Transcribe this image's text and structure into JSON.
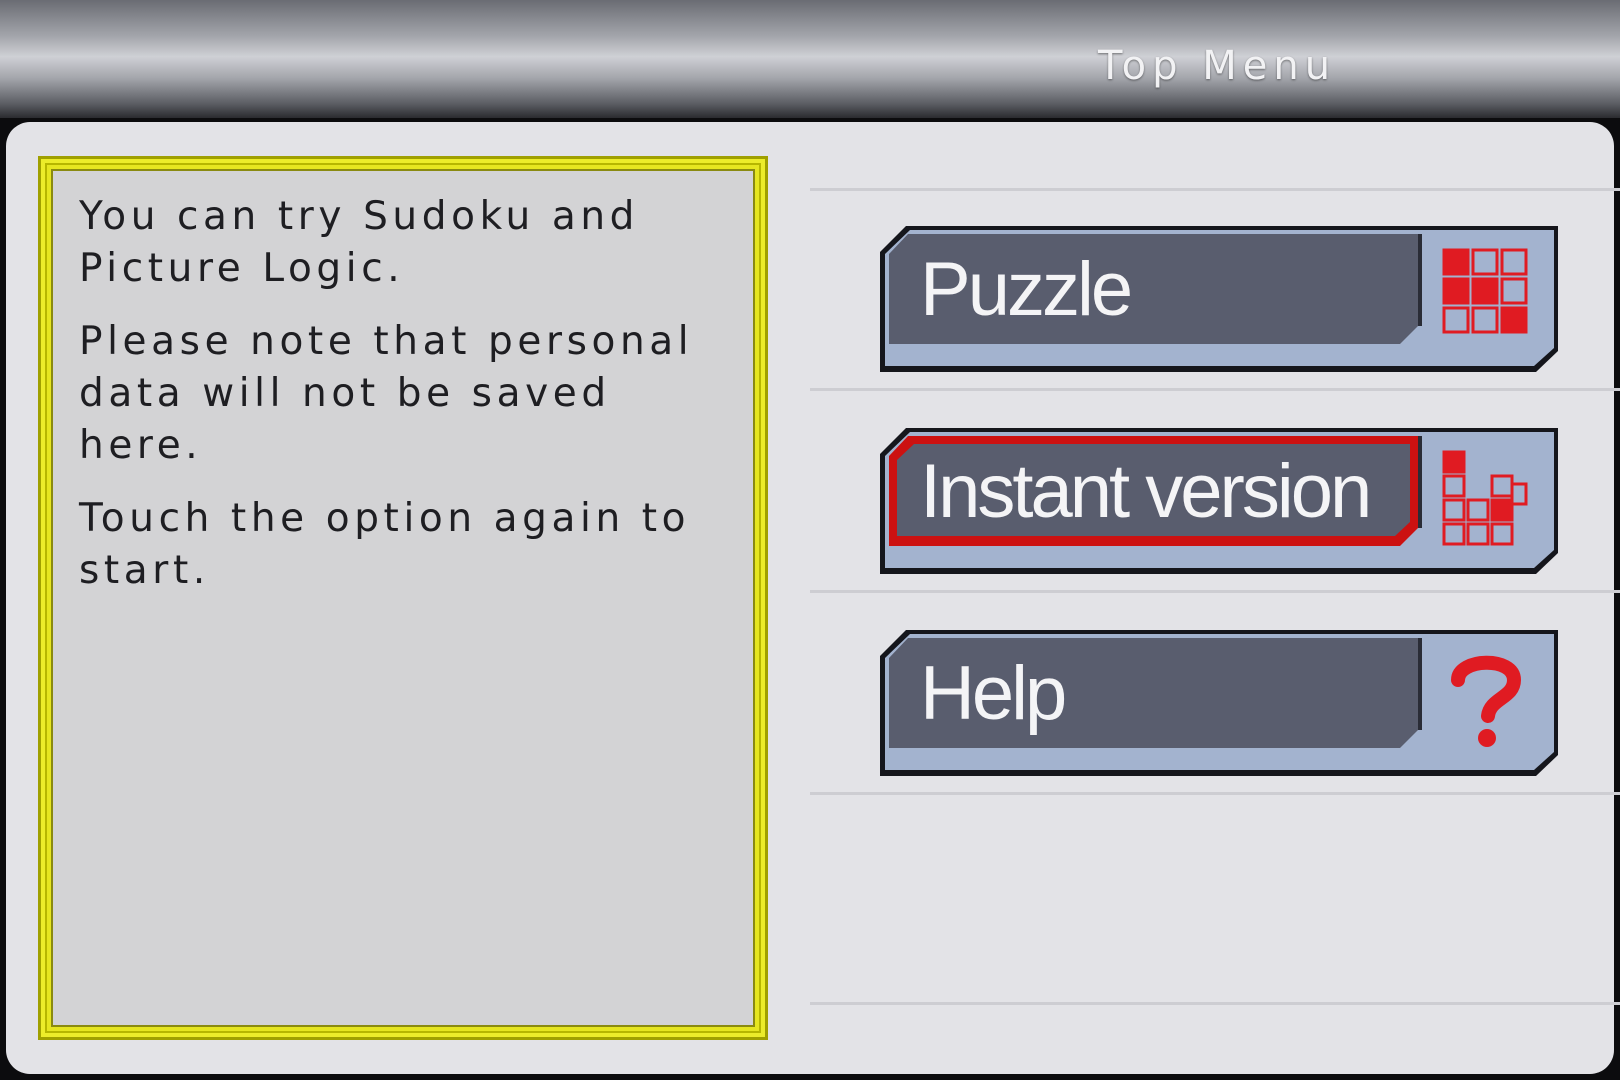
{
  "header": {
    "title": "Top Menu"
  },
  "info": {
    "paragraphs": [
      "You can try Sudoku and Picture Logic.",
      "Please note that personal data will not be saved here.",
      "Touch the option again to start."
    ]
  },
  "menu": {
    "items": [
      {
        "label": "Puzzle",
        "icon": "puzzle-grid-icon",
        "selected": false
      },
      {
        "label": "Instant version",
        "icon": "blocks-icon",
        "selected": true
      },
      {
        "label": "Help",
        "icon": "question-mark-icon",
        "selected": false
      }
    ]
  },
  "colors": {
    "button_dark": "#595d6e",
    "button_light": "#a3b3cf",
    "icon_red": "#e01b22",
    "selected_border": "#cc1111",
    "info_border": "#e6e620"
  }
}
